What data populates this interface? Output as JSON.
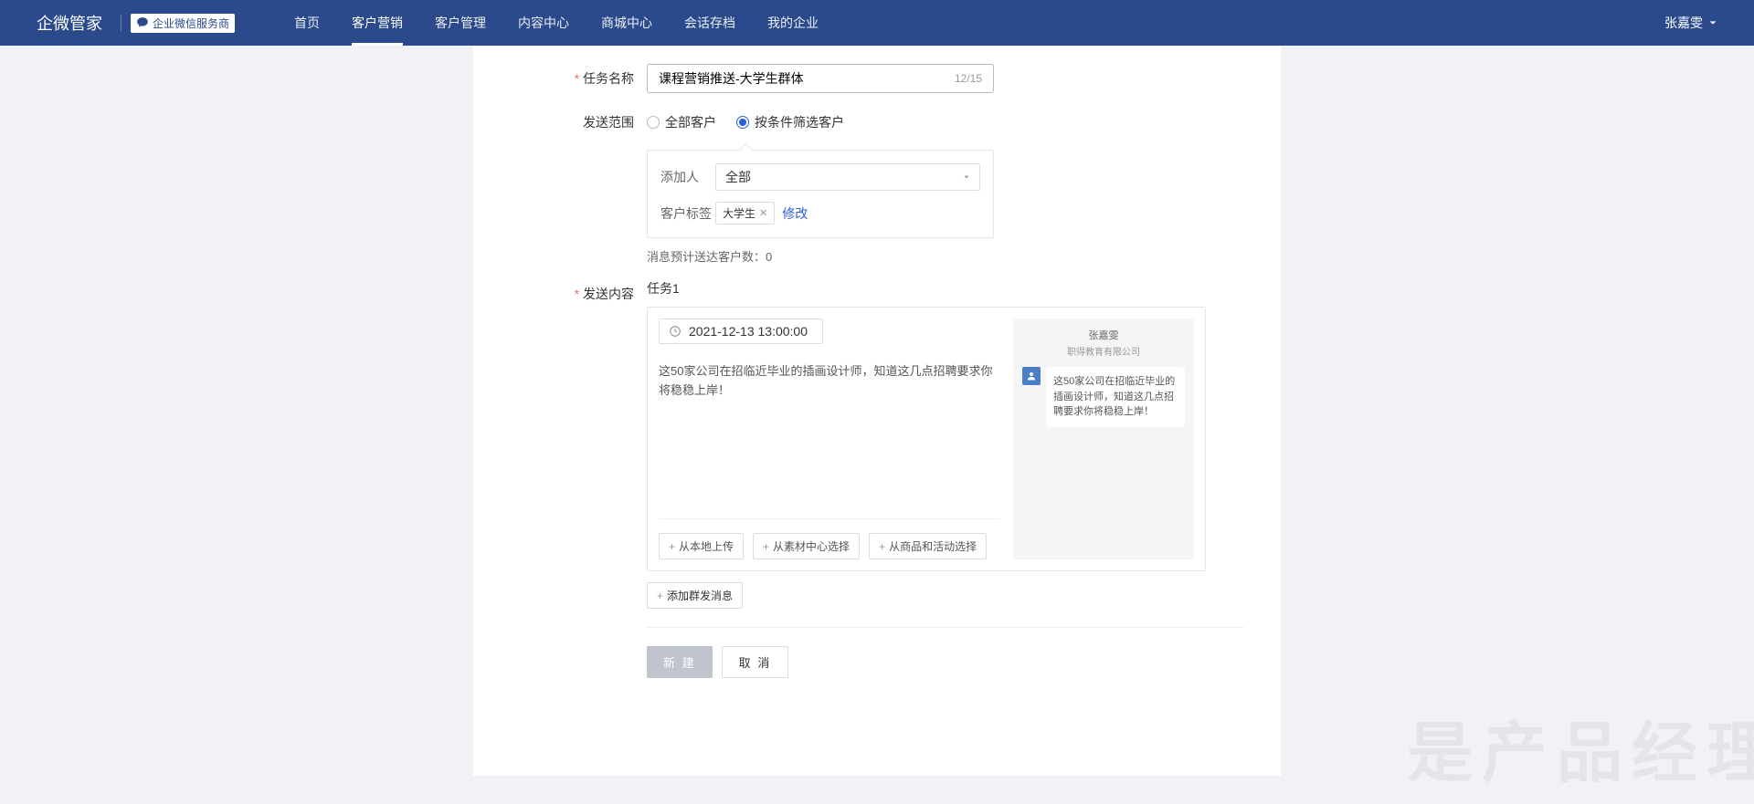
{
  "header": {
    "logo": "企微管家",
    "badge": "企业微信服务商",
    "nav": [
      "首页",
      "客户营销",
      "客户管理",
      "内容中心",
      "商城中心",
      "会话存档",
      "我的企业"
    ],
    "activeIndex": 1,
    "user": "张嘉雯"
  },
  "form": {
    "taskName": {
      "label": "任务名称",
      "value": "课程营销推送-大学生群体",
      "count": "12/15"
    },
    "sendRange": {
      "label": "发送范围",
      "options": [
        "全部客户",
        "按条件筛选客户"
      ]
    },
    "filters": {
      "addPerson": {
        "label": "添加人",
        "value": "全部"
      },
      "customerTag": {
        "label": "客户标签",
        "tag": "大学生",
        "modify": "修改"
      }
    },
    "msgCount": {
      "label": "消息预计送达客户数：",
      "value": "0"
    },
    "sendContent": {
      "label": "发送内容",
      "taskTitle": "任务1",
      "datetime": "2021-12-13 13:00:00",
      "text": "这50家公司在招临近毕业的插画设计师，知道这几点招聘要求你将稳稳上岸！",
      "uploadBtns": [
        "从本地上传",
        "从素材中心选择",
        "从商品和活动选择"
      ]
    },
    "preview": {
      "name": "张嘉雯",
      "company": "职得教育有限公司",
      "bubble": "这50家公司在招临近毕业的插画设计师，知道这几点招聘要求你将稳稳上岸！"
    },
    "addMsgBtn": "添加群发消息",
    "footer": {
      "create": "新 建",
      "cancel": "取 消"
    }
  },
  "watermark": "是产品经理"
}
